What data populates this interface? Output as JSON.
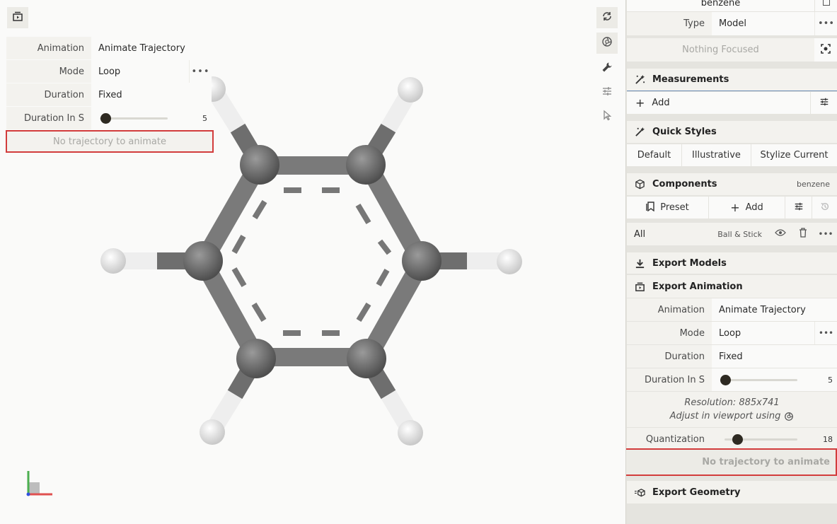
{
  "overlay": {
    "rows": [
      {
        "label": "Animation",
        "value": "Animate Trajectory"
      },
      {
        "label": "Mode",
        "value": "Loop"
      },
      {
        "label": "Duration",
        "value": "Fixed"
      },
      {
        "label": "Duration In S",
        "value": "5"
      }
    ],
    "duration_fraction": 0.0,
    "notice": "No trajectory to animate",
    "more_icon": "more-horizontal-icon"
  },
  "toolbar_icons": [
    "export-animation-icon",
    "reset-view-icon",
    "screenshot-icon",
    "wrench-icon",
    "sliders-icon",
    "select-cursor-icon"
  ],
  "panel": {
    "top_truncated": "benzene",
    "type_label": "Type",
    "type_value": "Model",
    "focus": "Nothing Focused",
    "measurements": {
      "title": "Measurements",
      "add": "Add"
    },
    "quick_styles": {
      "title": "Quick Styles",
      "buttons": [
        "Default",
        "Illustrative",
        "Stylize Current"
      ]
    },
    "components": {
      "title": "Components",
      "badge": "benzene",
      "preset": "Preset",
      "add": "Add"
    },
    "all_row": {
      "label": "All",
      "repr": "Ball & Stick"
    },
    "export_models": "Export Models",
    "export_animation": {
      "title": "Export Animation",
      "rows": [
        {
          "label": "Animation",
          "value": "Animate Trajectory"
        },
        {
          "label": "Mode",
          "value": "Loop"
        },
        {
          "label": "Duration",
          "value": "Fixed"
        }
      ],
      "duration_label": "Duration In S",
      "duration_value": "5",
      "resolution": "Resolution: 885x741",
      "adjust": "Adjust in viewport using",
      "quant_label": "Quantization",
      "quant_value": "18",
      "notice": "No trajectory to animate"
    },
    "export_geometry": "Export Geometry"
  },
  "colors": {
    "carbon": "#6e6e6e",
    "hydrogen": "#f0f0f0",
    "notice_border": "#d23c3c",
    "axis_x": "#e05050",
    "axis_y": "#4caf50",
    "axis_z": "#3050e0"
  }
}
